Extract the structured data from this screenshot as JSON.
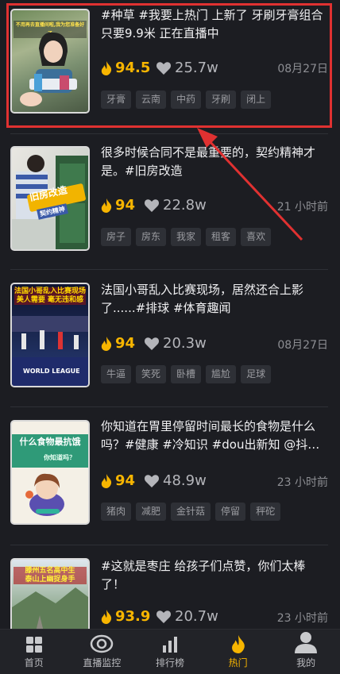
{
  "feed": [
    {
      "title": "#种草 #我要上热门 上新了 牙刷牙膏组合只要9.9米 正在直播中",
      "score": "94.5",
      "likes": "25.7w",
      "time": "08月27日",
      "tags": [
        "牙膏",
        "云南",
        "中药",
        "牙刷",
        "闭上"
      ],
      "thumb_text": "不用再去直播间啦,我为您准备好了"
    },
    {
      "title": "很多时候合同不是最重要的，契约精神才是。#旧房改造",
      "score": "94",
      "likes": "22.8w",
      "time": "21 小时前",
      "tags": [
        "房子",
        "房东",
        "我家",
        "租客",
        "喜欢"
      ],
      "thumb_text": "旧房改造",
      "thumb_sub": "契约精神"
    },
    {
      "title": "法国小哥乱入比赛现场，居然还合上影了......#排球 #体育趣闻",
      "score": "94",
      "likes": "20.3w",
      "time": "08月27日",
      "tags": [
        "牛逼",
        "笑死",
        "卧槽",
        "尴尬",
        "足球"
      ],
      "thumb_text": "法国小哥乱入比赛现场\n美人需要 毫无违和感",
      "thumb_sub": "WORLD LEAGUE"
    },
    {
      "title": "你知道在胃里停留时间最长的食物是什么吗？#健康 #冷知识 #dou出新知 @抖音...",
      "score": "94",
      "likes": "48.9w",
      "time": "23 小时前",
      "tags": [
        "猪肉",
        "减肥",
        "金针菇",
        "停留",
        "秤砣"
      ],
      "thumb_text": "什么食物最抗饿",
      "thumb_sub": "你知道吗？"
    },
    {
      "title": "#这就是枣庄 给孩子们点赞，你们太棒了！",
      "score": "93.9",
      "likes": "20.7w",
      "time": "23 小时前",
      "tags": [],
      "thumb_text": "滕州五名高中生\n泰山上幽捉身手"
    }
  ],
  "tabbar": [
    {
      "label": "首页",
      "icon": "home-grid-icon"
    },
    {
      "label": "直播监控",
      "icon": "eye-icon"
    },
    {
      "label": "排行榜",
      "icon": "bar-chart-icon"
    },
    {
      "label": "热门",
      "icon": "flame-icon"
    },
    {
      "label": "我的",
      "icon": "user-icon"
    }
  ],
  "colors": {
    "accent": "#f7b500",
    "highlight": "#e03131",
    "background": "#1c1d22"
  }
}
